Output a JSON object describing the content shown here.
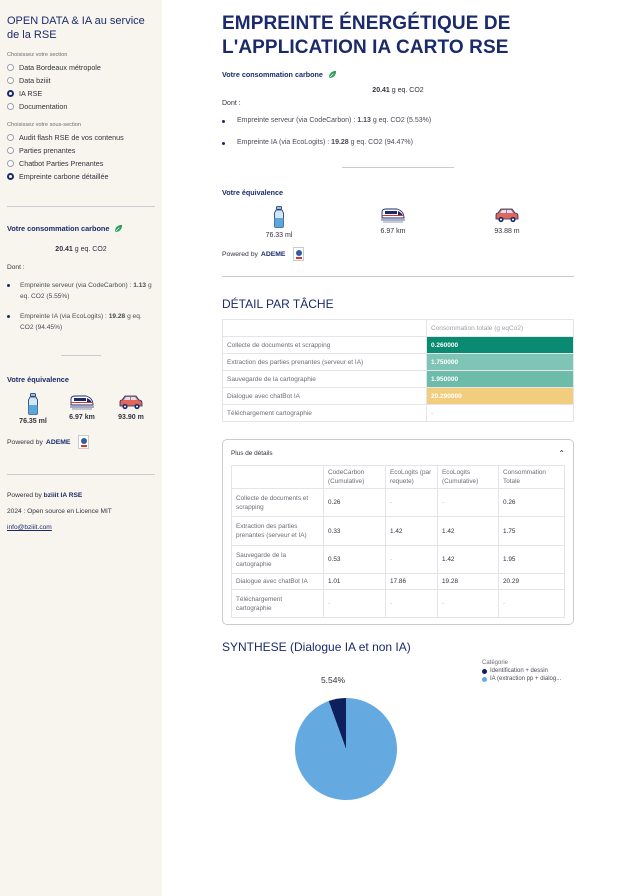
{
  "sidebar": {
    "title": "OPEN DATA & IA au service de la RSE",
    "section_caption": "Choisissez votre section",
    "sections": [
      {
        "label": "Data Bordeaux métropole",
        "selected": false
      },
      {
        "label": "Data bziiit",
        "selected": false
      },
      {
        "label": "IA RSE",
        "selected": true
      },
      {
        "label": "Documentation",
        "selected": false
      }
    ],
    "subsection_caption": "Choisissez votre sous-section",
    "subsections": [
      {
        "label": "Audit flash RSE de vos contenus",
        "selected": false
      },
      {
        "label": "Parties prenantes",
        "selected": false
      },
      {
        "label": "Chatbot Parties Prenantes",
        "selected": false
      },
      {
        "label": "Empreinte carbone détaillée",
        "selected": true
      }
    ],
    "consumption_title": "Votre consommation carbone",
    "consumption_value": "20.41",
    "consumption_unit": "g eq. CO2",
    "dont_label": "Dont :",
    "server_prefix": "Empreinte serveur (via CodeCarbon) :",
    "server_value": "1.13",
    "server_suffix": "g eq. CO2 (5.55%)",
    "ia_prefix": "Empreinte IA (via EcoLogits) :",
    "ia_value": "19.28",
    "ia_suffix": "g eq. CO2 (94.45%)",
    "equivalence_title": "Votre équivalence",
    "equivalences": [
      "76.35 ml",
      "6.97 km",
      "93.90 m"
    ],
    "powered_by": "Powered by",
    "ademe": "ADEME",
    "footer_powered": "Powered by",
    "footer_brand": "bziiit IA RSE",
    "footer_license": "2024 : Open source en Licence MIT",
    "footer_email": "info@bziiit.com"
  },
  "main": {
    "title": "EMPREINTE ÉNERGÉTIQUE DE L'APPLICATION IA CARTO RSE",
    "consumption_title": "Votre consommation carbone",
    "consumption_value": "20.41",
    "consumption_unit": "g eq. CO2",
    "dont_label": "Dont :",
    "server_prefix": "Empreinte serveur (via CodeCarbon) :",
    "server_value": "1.13",
    "server_suffix": "g eq. CO2 (5.53%)",
    "ia_prefix": "Empreinte IA (via EcoLogits) :",
    "ia_value": "19.28",
    "ia_suffix": "g eq. CO2 (94.47%)",
    "equivalence_title": "Votre équivalence",
    "equivalences": [
      "76.33 ml",
      "6.97 km",
      "93.88 m"
    ],
    "powered_by": "Powered by",
    "ademe": "ADEME",
    "task_title": "DÉTAIL PAR TÂCHE",
    "task_header": "Consommation totale (g eqCo2)",
    "tasks": [
      {
        "name": "Collecte de documents et scrapping",
        "value": "0.260000",
        "color": "#0b8a72"
      },
      {
        "name": "Extraction des parties prenantes (serveur et IA)",
        "value": "1.750000",
        "color": "#7fc4b5"
      },
      {
        "name": "Sauvegarde de la cartographie",
        "value": "1.950000",
        "color": "#6dbcaa"
      },
      {
        "name": "Dialogue avec chatBot IA",
        "value": "20.290000",
        "color": "#f2cd7e"
      },
      {
        "name": "Téléchargement cartographie",
        "value": "-",
        "color": ""
      }
    ],
    "details_label": "Plus de détails",
    "details_headers": [
      "",
      "CodeCarbon (Cumulative)",
      "EcoLogits (par requete)",
      "EcoLogits (Cumulative)",
      "Consommation Totale"
    ],
    "details_rows": [
      [
        "Collecte de documents et scrapping",
        "0.26",
        "-",
        "-",
        "0.26"
      ],
      [
        "Extraction des parties prenantes (serveur et IA)",
        "0.33",
        "1.42",
        "1.42",
        "1.75"
      ],
      [
        "Sauvegarde de la cartographie",
        "0.53",
        "-",
        "1.42",
        "1.95"
      ],
      [
        "Dialogue avec chatBot IA",
        "1.01",
        "17.86",
        "19.28",
        "20.29"
      ],
      [
        "Téléchargement cartographie",
        "-",
        "-",
        "-",
        "-"
      ]
    ],
    "synthese_title": "SYNTHESE (Dialogue IA et non IA)"
  },
  "chart_data": {
    "type": "pie",
    "title": "SYNTHESE (Dialogue IA et non IA)",
    "legend_title": "Catégorie",
    "legend_position": "top-right",
    "slices": [
      {
        "name": "Identification + dessin",
        "value": 5.54,
        "label": "5.54%",
        "color": "#0d1f5c"
      },
      {
        "name": "IA (extraction pp + dialog...",
        "value": 94.46,
        "label": "94.46%",
        "color": "#64aae0"
      }
    ]
  }
}
